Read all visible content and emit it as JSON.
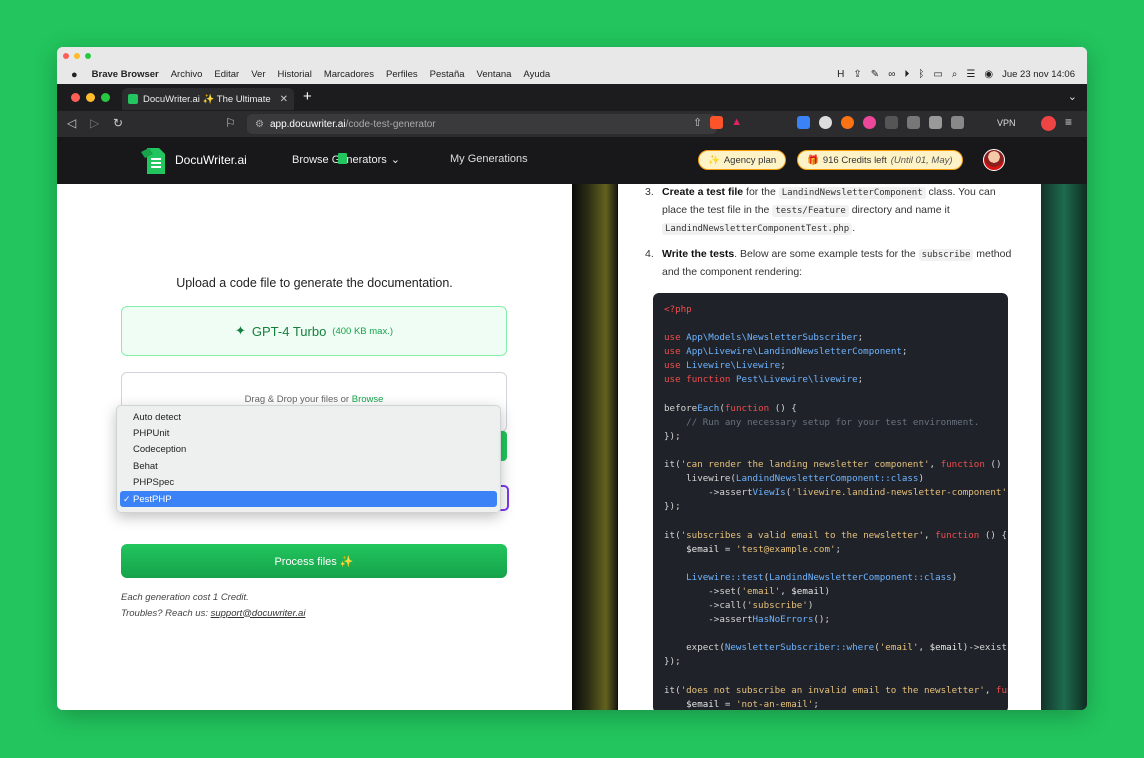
{
  "os_menu": {
    "app_name": "Brave Browser",
    "items": [
      "Archivo",
      "Editar",
      "Ver",
      "Historial",
      "Marcadores",
      "Perfiles",
      "Pestaña",
      "Ventana",
      "Ayuda"
    ],
    "clock": "Jue 23 nov  14:06"
  },
  "browser": {
    "tab_title": "DocuWriter.ai ✨ The Ultimate",
    "url_host": "app.docuwriter.ai",
    "url_path": "/code-test-generator",
    "vpn_label": "VPN"
  },
  "app_header": {
    "brand": "DocuWriter.ai",
    "browse": "Browse Generators",
    "my_generations": "My Generations",
    "plan": "Agency plan",
    "credits": "916 Credits left",
    "credits_until": "(Until 01, May)"
  },
  "upload": {
    "title": "Upload a code file to generate the documentation.",
    "model": "GPT-4 Turbo",
    "model_limit": "(400 KB max.)",
    "drop_text": "Drag & Drop your files or ",
    "browse_link": "Browse",
    "framework_options": [
      "Auto detect",
      "PHPUnit",
      "Codeception",
      "Behat",
      "PHPSpec",
      "PestPHP"
    ],
    "selected_framework": "PestPHP",
    "process_button": "Process files ✨",
    "cost_note": "Each generation cost 1 Credit.",
    "support_note": "Troubles? Reach us: ",
    "support_email": "support@docuwriter.ai"
  },
  "doc": {
    "step3": {
      "num": "3.",
      "bold": "Create a test file",
      "t1": " for the ",
      "code1": "LandindNewsletterComponent",
      "t2": " class. You can place the test file in the ",
      "code2": "tests/Feature",
      "t3": " directory and name it ",
      "code3": "LandindNewsletterComponentTest.php",
      "t4": "."
    },
    "step4": {
      "num": "4.",
      "bold": "Write the tests",
      "t1": ". Below are some example tests for the ",
      "code1": "subscribe",
      "t2": " method and the component rendering:"
    },
    "code": [
      "<?php",
      "",
      "use App\\Models\\NewsletterSubscriber;",
      "use App\\Livewire\\LandindNewsletterComponent;",
      "use Livewire\\Livewire;",
      "use function Pest\\Livewire\\livewire;",
      "",
      "beforeEach(function () {",
      "    // Run any necessary setup for your test environment.",
      "});",
      "",
      "it('can render the landing newsletter component', function () {",
      "    livewire(LandindNewsletterComponent::class)",
      "        ->assertViewIs('livewire.landind-newsletter-component');",
      "});",
      "",
      "it('subscribes a valid email to the newsletter', function () {",
      "    $email = 'test@example.com';",
      "",
      "    Livewire::test(LandindNewsletterComponent::class)",
      "        ->set('email', $email)",
      "        ->call('subscribe')",
      "        ->assertHasNoErrors();",
      "",
      "    expect(NewsletterSubscriber::where('email', $email)->exists())",
      "});",
      "",
      "it('does not subscribe an invalid email to the newsletter', fun",
      "    $email = 'not-an-email';"
    ]
  },
  "colors": {
    "background": "#22c55e",
    "accent_green": "#16a34a",
    "code_bg": "#1f2329",
    "keyword": "#f14c4c",
    "class_name": "#6fb3ff",
    "string": "#e6c07b",
    "selection": "#3b82f6"
  }
}
